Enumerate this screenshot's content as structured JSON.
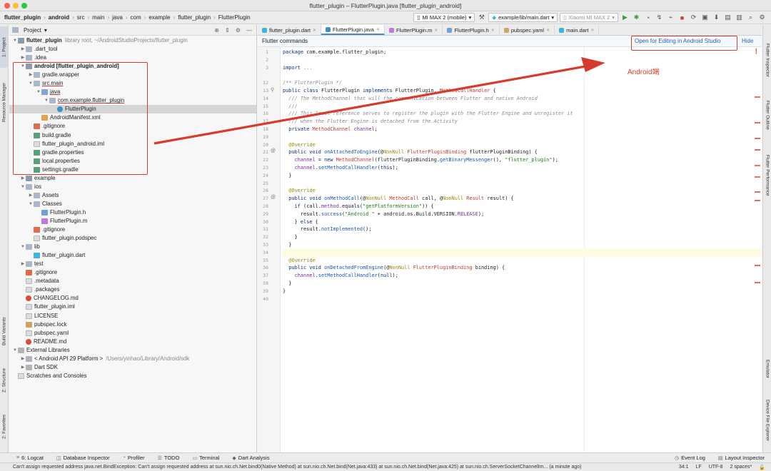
{
  "window": {
    "title": "flutter_plugin – FlutterPlugin.java [flutter_plugin_android]"
  },
  "breadcrumbs": [
    "flutter_plugin",
    "android",
    "src",
    "main",
    "java",
    "com",
    "example",
    "flutter_plugin",
    "FlutterPlugin"
  ],
  "toolbar": {
    "device_select": "MI MAX 2 (mobile)",
    "run_config": "example/lib/main.dart",
    "device_dim": "Xiaomi MI MAX 2"
  },
  "left_strip": [
    "1: Project",
    "Resource Manager",
    "Build Variants",
    "Z: Structure",
    "2: Favorites"
  ],
  "right_strip": [
    "Flutter Inspector",
    "Flutter Outline",
    "Flutter Performance",
    "Emulator",
    "Device File Explorer"
  ],
  "project_panel": {
    "header": "Project",
    "items": [
      {
        "label": "flutter_plugin",
        "extra": "library root, ~/AndroidStudioProjects/flutter_plugin",
        "bold": true,
        "depth": 0,
        "arrow": "▼",
        "icon": "module-icon"
      },
      {
        "label": ".dart_tool",
        "depth": 1,
        "arrow": "▶",
        "icon": "folder-icon"
      },
      {
        "label": ".idea",
        "depth": 1,
        "arrow": "▶",
        "icon": "folder-icon"
      },
      {
        "label": "android [flutter_plugin_android]",
        "depth": 1,
        "arrow": "▼",
        "icon": "module-icon",
        "bold": true
      },
      {
        "label": "gradle.wrapper",
        "depth": 2,
        "arrow": "▶",
        "icon": "folder-icon"
      },
      {
        "label": "src.main",
        "depth": 2,
        "arrow": "▼",
        "icon": "folder-icon",
        "underline": true
      },
      {
        "label": "java",
        "depth": 3,
        "arrow": "▼",
        "icon": "folder-blue-icon",
        "underline": true
      },
      {
        "label": "com.example.flutter_plugin",
        "depth": 4,
        "arrow": "▼",
        "icon": "folder-icon",
        "underline": true
      },
      {
        "label": "FlutterPlugin",
        "depth": 5,
        "arrow": "",
        "icon": "class-icon",
        "selected": true
      },
      {
        "label": "AndroidManifest.xml",
        "depth": 3,
        "arrow": "",
        "icon": "xml-icon"
      },
      {
        "label": ".gitignore",
        "depth": 2,
        "arrow": "",
        "icon": "git-icon"
      },
      {
        "label": "build.gradle",
        "depth": 2,
        "arrow": "",
        "icon": "gradle-icon"
      },
      {
        "label": "flutter_plugin_android.iml",
        "depth": 2,
        "arrow": "",
        "icon": "file-icon"
      },
      {
        "label": "gradle.properties",
        "depth": 2,
        "arrow": "",
        "icon": "gradle-icon"
      },
      {
        "label": "local.properties",
        "depth": 2,
        "arrow": "",
        "icon": "gradle-icon"
      },
      {
        "label": "settings.gradle",
        "depth": 2,
        "arrow": "",
        "icon": "gradle-icon"
      },
      {
        "label": "example",
        "depth": 1,
        "arrow": "▶",
        "icon": "module-icon"
      },
      {
        "label": "ios",
        "depth": 1,
        "arrow": "▼",
        "icon": "folder-icon"
      },
      {
        "label": "Assets",
        "depth": 2,
        "arrow": "▶",
        "icon": "folder-icon"
      },
      {
        "label": "Classes",
        "depth": 2,
        "arrow": "▼",
        "icon": "folder-icon"
      },
      {
        "label": "FlutterPlugin.h",
        "depth": 3,
        "arrow": "",
        "icon": "h-file-icon"
      },
      {
        "label": "FlutterPlugin.m",
        "depth": 3,
        "arrow": "",
        "icon": "m-file-icon"
      },
      {
        "label": ".gitignore",
        "depth": 2,
        "arrow": "",
        "icon": "git-icon"
      },
      {
        "label": "flutter_plugin.podspec",
        "depth": 2,
        "arrow": "",
        "icon": "file-icon"
      },
      {
        "label": "lib",
        "depth": 1,
        "arrow": "▼",
        "icon": "folder-icon"
      },
      {
        "label": "flutter_plugin.dart",
        "depth": 2,
        "arrow": "",
        "icon": "dart-icon"
      },
      {
        "label": "test",
        "depth": 1,
        "arrow": "▶",
        "icon": "folder-icon"
      },
      {
        "label": ".gitignore",
        "depth": 1,
        "arrow": "",
        "icon": "git-icon"
      },
      {
        "label": ".metadata",
        "depth": 1,
        "arrow": "",
        "icon": "file-icon"
      },
      {
        "label": ".packages",
        "depth": 1,
        "arrow": "",
        "icon": "file-icon"
      },
      {
        "label": "CHANGELOG.md",
        "depth": 1,
        "arrow": "",
        "icon": "md-icon"
      },
      {
        "label": "flutter_plugin.iml",
        "depth": 1,
        "arrow": "",
        "icon": "file-icon"
      },
      {
        "label": "LICENSE",
        "depth": 1,
        "arrow": "",
        "icon": "file-icon"
      },
      {
        "label": "pubspec.lock",
        "depth": 1,
        "arrow": "",
        "icon": "lock-file-icon"
      },
      {
        "label": "pubspec.yaml",
        "depth": 1,
        "arrow": "",
        "icon": "file-icon"
      },
      {
        "label": "README.md",
        "depth": 1,
        "arrow": "",
        "icon": "md-icon"
      },
      {
        "label": "External Libraries",
        "depth": 0,
        "arrow": "▼",
        "icon": "library-icon"
      },
      {
        "label": "< Android API 29 Platform >",
        "extra": "/Users/yinhao/Library/Android/sdk",
        "depth": 1,
        "arrow": "▶",
        "icon": "library-icon"
      },
      {
        "label": "Dart SDK",
        "depth": 1,
        "arrow": "▶",
        "icon": "library-icon"
      },
      {
        "label": "Scratches and Consoles",
        "depth": 0,
        "arrow": "",
        "icon": "scratch-icon"
      }
    ]
  },
  "editor": {
    "tabs": [
      {
        "label": "flutter_plugin.dart",
        "color": "#3db3e0",
        "active": false
      },
      {
        "label": "FlutterPlugin.java",
        "color": "#3f8ec7",
        "active": true
      },
      {
        "label": "FlutterPlugin.m",
        "color": "#c07ad6",
        "active": false
      },
      {
        "label": "FlutterPlugin.h",
        "color": "#6ea0d0",
        "active": false
      },
      {
        "label": "pubspec.yaml",
        "color": "#c9a664",
        "active": false
      },
      {
        "label": "main.dart",
        "color": "#3db3e0",
        "active": false
      }
    ],
    "banner_text": "Flutter commands",
    "banner_open": "Open for Editing in Android Studio",
    "banner_hide": "Hide",
    "line_numbers": [
      "1",
      "2",
      "3",
      "",
      "12",
      "13",
      "14",
      "15",
      "16",
      "17",
      "18",
      "19",
      "20",
      "21",
      "22",
      "23",
      "24",
      "25",
      "26",
      "27",
      "28",
      "29",
      "30",
      "31",
      "32",
      "33",
      "34",
      "35",
      "36",
      "37",
      "38",
      "39",
      "40"
    ]
  },
  "annotation": {
    "label": "Android端",
    "color": "#d63b2b"
  },
  "bottom_tabs": [
    {
      "label": "6: Logcat",
      "icon": "logcat-icon"
    },
    {
      "label": "Database Inspector",
      "icon": "database-icon"
    },
    {
      "label": "Profiler",
      "icon": "profiler-icon"
    },
    {
      "label": "TODO",
      "icon": "todo-icon"
    },
    {
      "label": "Terminal",
      "icon": "terminal-icon"
    },
    {
      "label": "Dart Analysis",
      "icon": "dart-analysis-icon"
    }
  ],
  "bottom_right_tabs": [
    {
      "label": "Event Log",
      "icon": "event-log-icon"
    },
    {
      "label": "Layout Inspector",
      "icon": "layout-inspector-icon"
    }
  ],
  "status": {
    "message": "Can't assign requested address java.net.BindException: Can't assign requested address at sun.nio.ch.Net.bind0(Native Method) at sun.nio.ch.Net.bind(Net.java:433) at sun.nio.ch.Net.bind(Net.java:425) at sun.nio.ch.ServerSocketChannelIm... (a minute ago)",
    "position": "34:1",
    "line_sep": "LF",
    "encoding": "UTF-8",
    "indent": "2 spaces*"
  }
}
